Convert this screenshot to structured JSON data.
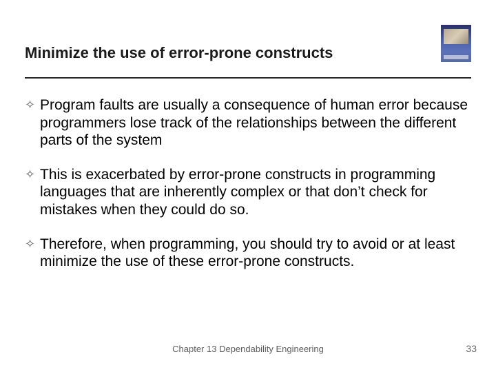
{
  "title": "Minimize the use of error-prone constructs",
  "bullets": [
    "Program faults are usually a consequence of human error because programmers lose track of the relationships between the different parts of the system",
    "This is exacerbated by error-prone constructs in programming languages that are inherently complex or that don’t check for mistakes when they could do so.",
    "Therefore, when programming, you should try to avoid or at least minimize the use of these error-prone constructs."
  ],
  "footer": {
    "center": "Chapter 13 Dependability Engineering",
    "page": "33"
  },
  "bullet_glyph": "✧"
}
